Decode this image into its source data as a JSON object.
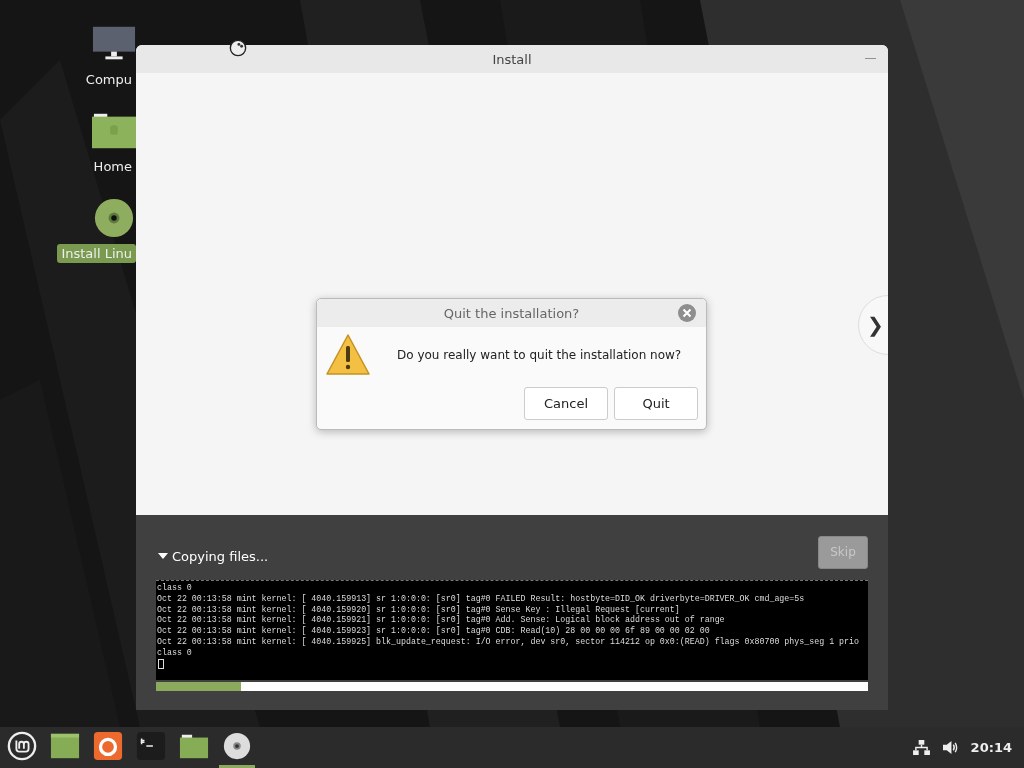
{
  "desktop_icons": [
    {
      "kind": "computer",
      "label": "Compu",
      "selected": false
    },
    {
      "kind": "folder",
      "label": "Home",
      "selected": false
    },
    {
      "kind": "disc",
      "label": "Install Linu",
      "selected": true
    }
  ],
  "window": {
    "title": "Install",
    "minimize": "—",
    "next_button": "❯"
  },
  "dialog": {
    "title": "Quit the installation?",
    "message": "Do you really want to quit the installation now?",
    "buttons": [
      {
        "label": "Cancel"
      },
      {
        "label": "Quit"
      }
    ]
  },
  "progress": {
    "label": "Copying files...",
    "expanded": true,
    "skip_button": {
      "label": "Skip",
      "disabled": true
    },
    "log": [
      "class 0",
      "Oct 22 00:13:58 mint kernel: [ 4040.159913] sr 1:0:0:0: [sr0] tag#0 FAILED Result: hostbyte=DID_OK driverbyte=DRIVER_OK cmd_age=5s",
      "Oct 22 00:13:58 mint kernel: [ 4040.159920] sr 1:0:0:0: [sr0] tag#0 Sense Key : Illegal Request [current]",
      "Oct 22 00:13:58 mint kernel: [ 4040.159921] sr 1:0:0:0: [sr0] tag#0 Add. Sense: Logical block address out of range",
      "Oct 22 00:13:58 mint kernel: [ 4040.159923] sr 1:0:0:0: [sr0] tag#0 CDB: Read(10) 28 00 00 00 6f 89 00 00 02 00",
      "Oct 22 00:13:58 mint kernel: [ 4040.159925] blk_update_request: I/O error, dev sr0, sector 114212 op 0x0:(READ) flags 0x80700 phys_seg 1 prio",
      "class 0"
    ],
    "level": 0.12
  },
  "taskbar": {
    "launchers": [
      {
        "kind": "menu",
        "active": false
      },
      {
        "kind": "files",
        "active": false
      },
      {
        "kind": "browser",
        "active": false
      },
      {
        "kind": "terminal",
        "active": false
      },
      {
        "kind": "folder",
        "active": false
      },
      {
        "kind": "disc",
        "active": true
      }
    ],
    "clock": "20:14"
  }
}
